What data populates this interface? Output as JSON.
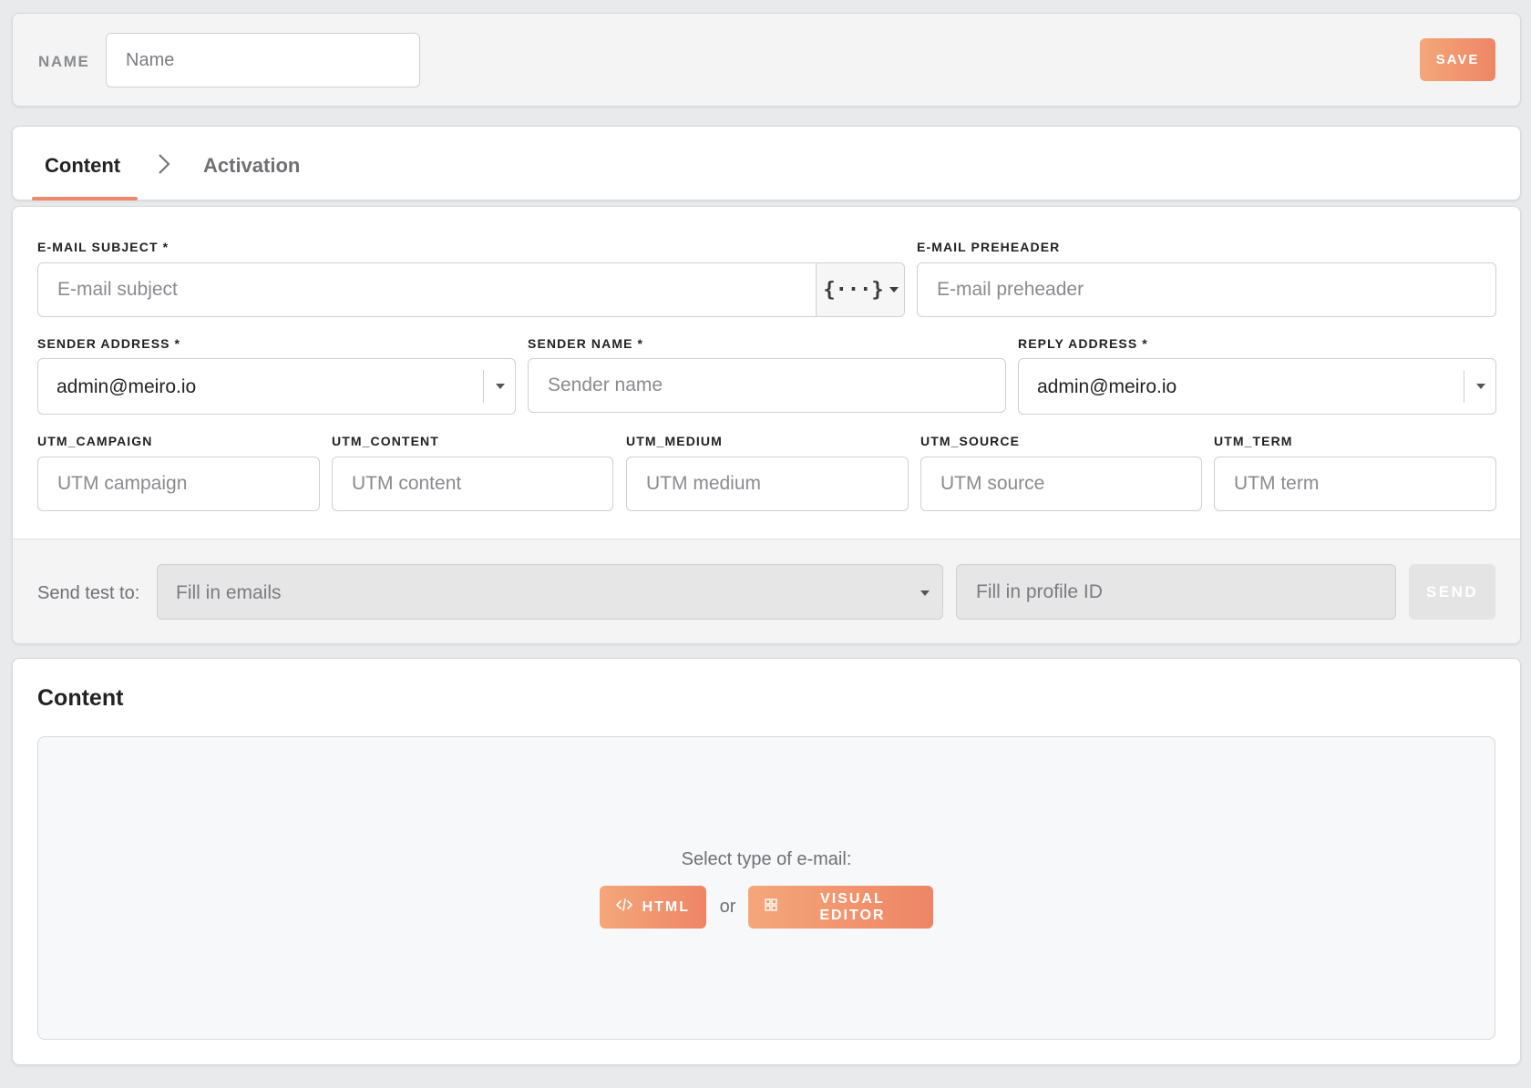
{
  "header": {
    "name_label": "NAME",
    "name_placeholder": "Name",
    "save_label": "SAVE"
  },
  "tabs": [
    {
      "label": "Content",
      "active": true
    },
    {
      "label": "Activation",
      "active": false
    }
  ],
  "form": {
    "subject_label": "E-MAIL SUBJECT *",
    "subject_placeholder": "E-mail subject",
    "preheader_label": "E-MAIL PREHEADER",
    "preheader_placeholder": "E-mail preheader",
    "sender_address_label": "SENDER ADDRESS *",
    "sender_address_value": "admin@meiro.io",
    "sender_name_label": "SENDER NAME *",
    "sender_name_placeholder": "Sender name",
    "reply_address_label": "REPLY ADDRESS *",
    "reply_address_value": "admin@meiro.io",
    "utm": [
      {
        "label": "UTM_CAMPAIGN",
        "placeholder": "UTM campaign"
      },
      {
        "label": "UTM_CONTENT",
        "placeholder": "UTM content"
      },
      {
        "label": "UTM_MEDIUM",
        "placeholder": "UTM medium"
      },
      {
        "label": "UTM_SOURCE",
        "placeholder": "UTM source"
      },
      {
        "label": "UTM_TERM",
        "placeholder": "UTM term"
      }
    ]
  },
  "test": {
    "label": "Send test to:",
    "emails_placeholder": "Fill in emails",
    "profile_placeholder": "Fill in profile ID",
    "send_label": "SEND"
  },
  "content": {
    "title": "Content",
    "select_type_text": "Select type of e-mail:",
    "html_label": "HTML",
    "or_text": "or",
    "visual_editor_label": "VISUAL EDITOR"
  },
  "colors": {
    "accent_start": "#f4a77a",
    "accent_end": "#ee8566",
    "background": "#e9eaec"
  },
  "icons": [
    "chevron-right-icon",
    "code-brackets-icon",
    "caret-down-icon",
    "code-icon",
    "grid-icon"
  ]
}
